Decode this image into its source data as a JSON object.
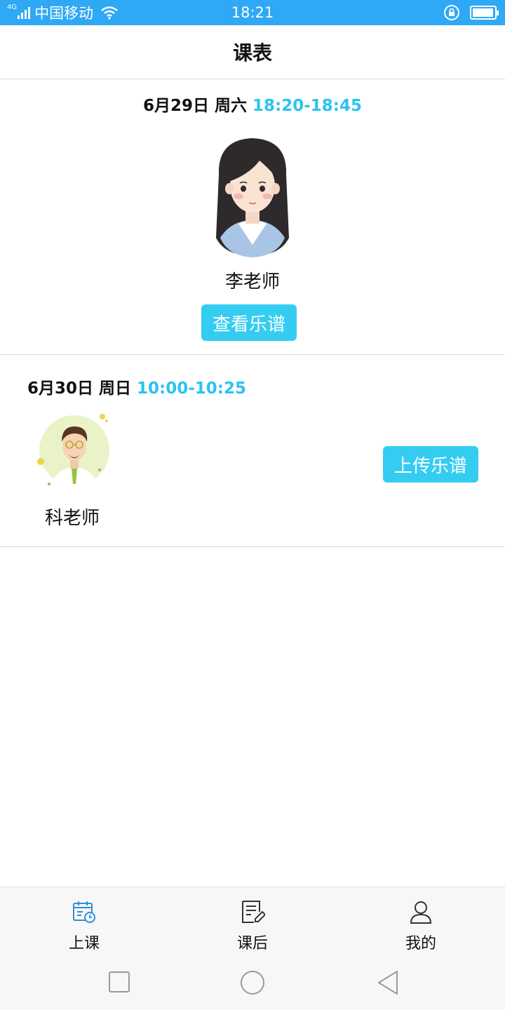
{
  "status_bar": {
    "network": "4G",
    "carrier": "中国移动",
    "time": "18:21",
    "battery_level": 0.95
  },
  "header": {
    "title": "课表"
  },
  "lessons": [
    {
      "date": "6月29日 周六",
      "time": "18:20-18:45",
      "teacher": "李老师",
      "avatar_icon": "female-teacher-avatar",
      "action_label": "查看乐谱"
    },
    {
      "date": "6月30日 周日",
      "time": "10:00-10:25",
      "teacher": "科老师",
      "avatar_icon": "male-teacher-avatar",
      "action_label": "上传乐谱"
    }
  ],
  "tab_bar": {
    "items": [
      {
        "label": "上课",
        "icon": "calendar-clock-icon",
        "active": true
      },
      {
        "label": "课后",
        "icon": "note-edit-icon",
        "active": false
      },
      {
        "label": "我的",
        "icon": "person-icon",
        "active": false
      }
    ]
  },
  "colors": {
    "status_bar": "#2fa8f5",
    "accent": "#2bc3ef",
    "button": "#35ccf2",
    "active_tab_icon": "#2f8fd6"
  }
}
